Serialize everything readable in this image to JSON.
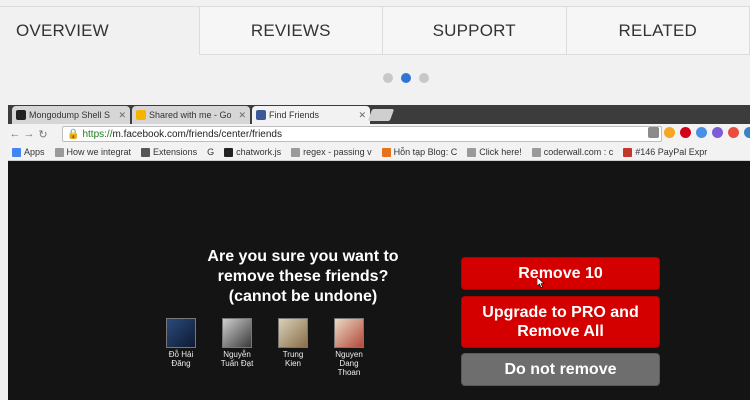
{
  "tabs": [
    {
      "label": "OVERVIEW",
      "active": true
    },
    {
      "label": "REVIEWS",
      "active": false
    },
    {
      "label": "SUPPORT",
      "active": false
    },
    {
      "label": "RELATED",
      "active": false
    }
  ],
  "carousel": {
    "count": 3,
    "active_index": 1
  },
  "browser": {
    "tabs": [
      {
        "label": "Mongodump Shell S",
        "icon": "github-icon"
      },
      {
        "label": "Shared with me - Go",
        "icon": "drive-icon"
      },
      {
        "label": "Find Friends",
        "icon": "facebook-icon"
      }
    ],
    "url_scheme": "https://",
    "url_rest": "m.facebook.com/friends/center/friends",
    "bookmarks": [
      "Apps",
      "How we integrat",
      "Extensions",
      "G",
      "chatwork.js",
      "regex - passing v",
      "Hỗn tạp Blog: C",
      "Click here!",
      "coderwall.com : c",
      "#146 PayPal Expr"
    ]
  },
  "dialog": {
    "question_line1": "Are you sure you want to",
    "question_line2": "remove these friends?",
    "question_line3": "(cannot be undone)",
    "friends": [
      {
        "name_line1": "Đỗ Hải",
        "name_line2": "Đăng",
        "name_line3": ""
      },
      {
        "name_line1": "Nguyễn",
        "name_line2": "Tuấn Đạt",
        "name_line3": ""
      },
      {
        "name_line1": "Trung",
        "name_line2": "Kien",
        "name_line3": ""
      },
      {
        "name_line1": "Nguyen",
        "name_line2": "Dang",
        "name_line3": "Thoan"
      }
    ],
    "remove_button": "Remove 10",
    "upgrade_line1": "Upgrade to PRO and",
    "upgrade_line2": "Remove All",
    "cancel_button": "Do not remove"
  },
  "colors": {
    "active_dot": "#2f74d6",
    "danger": "#d40000",
    "neutral_button": "#6e6e6e",
    "screen_bg": "#141414"
  }
}
